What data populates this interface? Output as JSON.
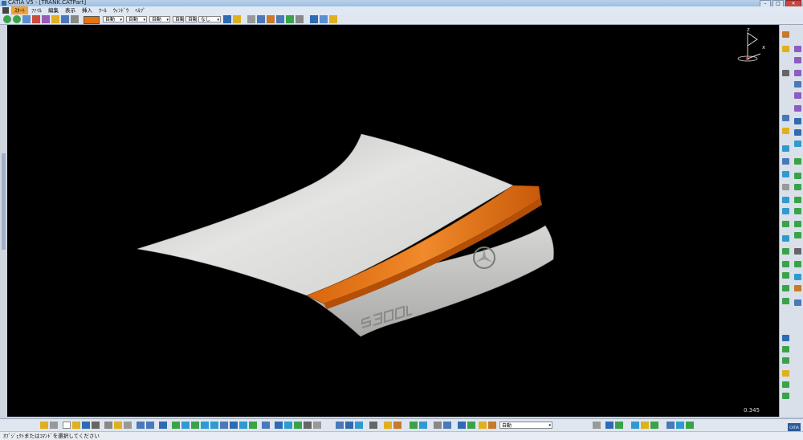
{
  "window": {
    "title": "CATIA V5 - [TRANK.CATPart]",
    "minimize": "–",
    "maximize": "□",
    "close": "✕"
  },
  "menubar": {
    "items": [
      "ｽﾀｰﾄ",
      "ﾌｧｲﾙ",
      "編集",
      "表示",
      "挿入",
      "ﾂｰﾙ",
      "ｳｨﾝﾄﾞｳ",
      "ﾍﾙﾌﾟ"
    ],
    "active_index": 0
  },
  "toolbar": {
    "color_swatch": "#e8730e",
    "selects": [
      {
        "value": "自動"
      },
      {
        "value": "自動"
      },
      {
        "value": "自動"
      },
      {
        "value": "自動"
      },
      {
        "value": "自動"
      },
      {
        "value": "なし"
      }
    ]
  },
  "viewport": {
    "background": "#000000",
    "scale_label": "0.345",
    "compass": {
      "z": "z",
      "x": "x",
      "y": "y"
    }
  },
  "bottom_toolbar": {
    "combo_value": "自動"
  },
  "status": {
    "text": "ｵﾌﾞｼﾞｪｸﾄまたはｺﾏﾝﾄﾞを選択してください"
  },
  "colors": {
    "accent_orange": "#e8730e",
    "surface_gray": "#d9d9d6"
  },
  "icons": [
    "app-icon",
    "menu-icon",
    "color-swatch",
    "compass-icon",
    "catia-logo"
  ]
}
